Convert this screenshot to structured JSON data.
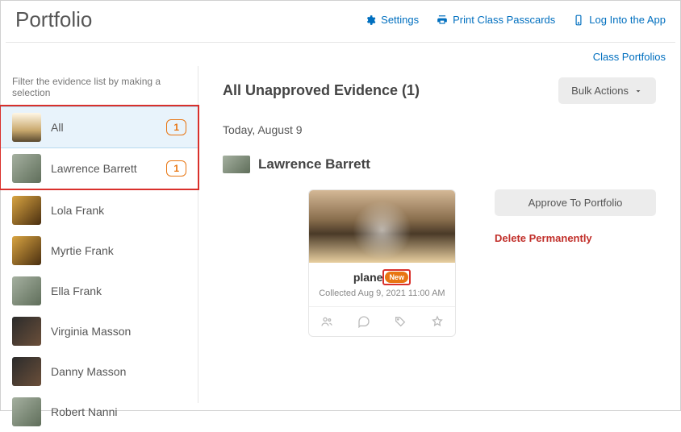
{
  "header": {
    "title": "Portfolio",
    "settings": "Settings",
    "print": "Print Class Passcards",
    "login": "Log Into the App"
  },
  "subheader": {
    "class_portfolios": "Class Portfolios"
  },
  "sidebar": {
    "filter_label": "Filter the evidence list by making a selection",
    "items": [
      {
        "name": "All",
        "count": "1",
        "avatar": "a-all"
      },
      {
        "name": "Lawrence Barrett",
        "count": "1",
        "avatar": "a-law"
      },
      {
        "name": "Lola Frank",
        "avatar": "a-dog"
      },
      {
        "name": "Myrtie Frank",
        "avatar": "a-dog"
      },
      {
        "name": "Ella Frank",
        "avatar": "a-law"
      },
      {
        "name": "Virginia Masson",
        "avatar": "a-pup"
      },
      {
        "name": "Danny Masson",
        "avatar": "a-pup"
      },
      {
        "name": "Robert Nanni",
        "avatar": "a-law"
      }
    ]
  },
  "main": {
    "title": "All Unapproved Evidence (1)",
    "bulk": "Bulk Actions",
    "date": "Today, August 9",
    "student_section": "Lawrence Barrett",
    "card": {
      "title": "plane",
      "new_label": "New",
      "collected": "Collected Aug 9, 2021 11:00 AM"
    },
    "approve": "Approve To Portfolio",
    "delete": "Delete Permanently"
  }
}
